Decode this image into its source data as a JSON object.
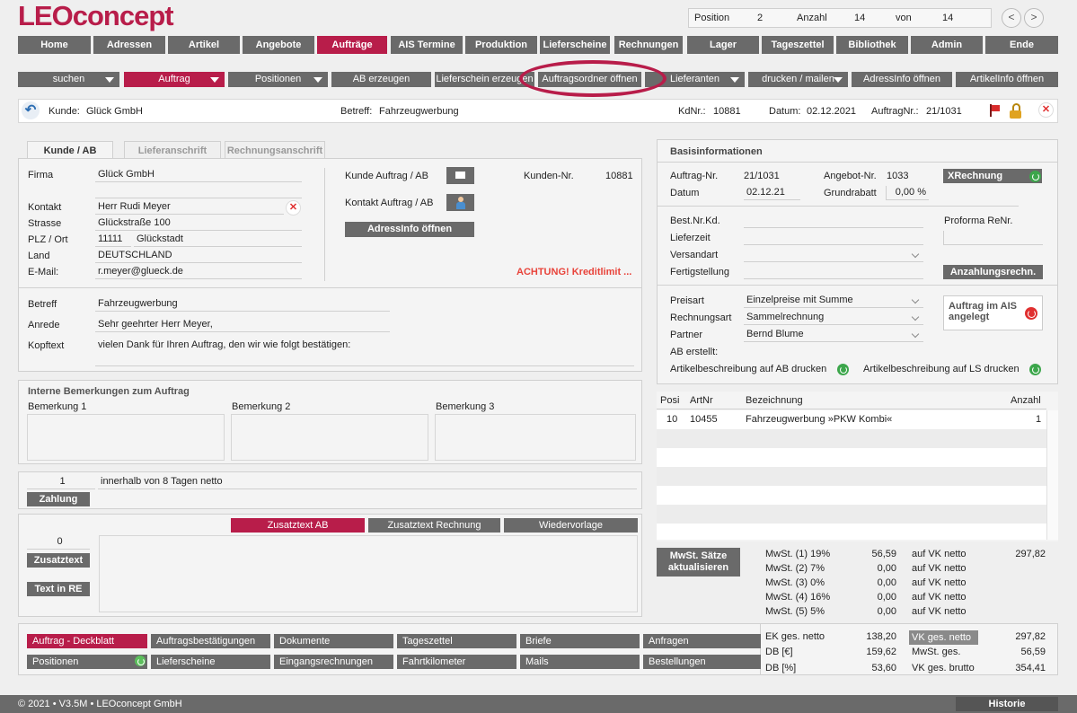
{
  "app": {
    "logo_leo": "LEO",
    "logo_concept": "concept"
  },
  "counter": {
    "position_label": "Position",
    "position": "2",
    "anzahl_label": "Anzahl",
    "anzahl": "14",
    "von_label": "von",
    "von": "14",
    "prev": "<",
    "next": ">"
  },
  "main_nav": [
    "Home",
    "Adressen",
    "Artikel",
    "Angebote",
    "Aufträge",
    "AIS Termine",
    "Produktion",
    "Lieferscheine",
    "Rechnungen",
    "Lager",
    "Tageszettel",
    "Bibliothek",
    "Admin",
    "Ende"
  ],
  "toolbar": [
    "suchen",
    "Auftrag",
    "Positionen",
    "AB erzeugen",
    "Lieferschein erzeugen",
    "Auftragsordner öffnen",
    "Lieferanten",
    "drucken / mailen",
    "AdressInfo öffnen",
    "ArtikelInfo öffnen"
  ],
  "infobar": {
    "kunde_label": "Kunde:",
    "kunde": "Glück GmbH",
    "betreff_label": "Betreff:",
    "betreff": "Fahrzeugwerbung",
    "kdnr_label": "KdNr.:",
    "kdnr": "10881",
    "datum_label": "Datum:",
    "datum": "02.12.2021",
    "auftragnr_label": "AuftragNr.:",
    "auftragnr": "21/1031"
  },
  "tabs": [
    "Kunde / AB",
    "Lieferanschrift",
    "Rechnungsanschrift"
  ],
  "kunde": {
    "firma_label": "Firma",
    "firma": "Glück GmbH",
    "kontakt_label": "Kontakt",
    "kontakt": "Herr Rudi Meyer",
    "strasse_label": "Strasse",
    "strasse": "Glückstraße 100",
    "plz_label": "PLZ / Ort",
    "plz": "11111",
    "ort": "Glückstadt",
    "land_label": "Land",
    "land": "DEUTSCHLAND",
    "email_label": "E-Mail:",
    "email": "r.meyer@glueck.de",
    "kunde_ab_label": "Kunde Auftrag / AB",
    "kontakt_ab_label": "Kontakt Auftrag / AB",
    "adressinfo_btn": "AdressInfo öffnen",
    "kundennr_label": "Kunden-Nr.",
    "kundennr": "10881",
    "warning": "ACHTUNG! Kreditlimit ...",
    "betreff_label": "Betreff",
    "betreff": "Fahrzeugwerbung",
    "anrede_label": "Anrede",
    "anrede": "Sehr geehrter Herr Meyer,",
    "kopftext_label": "Kopftext",
    "kopftext": "vielen Dank für Ihren Auftrag, den wir wie folgt bestätigen:"
  },
  "bemerkungen": {
    "title": "Interne Bemerkungen zum Auftrag",
    "b1": "Bemerkung 1",
    "b2": "Bemerkung 2",
    "b3": "Bemerkung 3"
  },
  "zahlung": {
    "nr": "1",
    "text": "innerhalb von 8 Tagen netto",
    "btn": "Zahlung"
  },
  "zusatz": {
    "count": "0",
    "btn_zusatztext": "Zusatztext",
    "btn_textinre": "Text in RE",
    "tab_ab": "Zusatztext AB",
    "tab_rechnung": "Zusatztext Rechnung",
    "tab_wiedervorlage": "Wiedervorlage"
  },
  "basis": {
    "title": "Basisinformationen",
    "auftragnr_label": "Auftrag-Nr.",
    "auftragnr": "21/1031",
    "angebotnr_label": "Angebot-Nr.",
    "angebotnr": "1033",
    "xrechnung_btn": "XRechnung",
    "datum_label": "Datum",
    "datum": "02.12.21",
    "grundrabatt_label": "Grundrabatt",
    "grundrabatt": "0,00 %",
    "bestnr_label": "Best.Nr.Kd.",
    "proforma_label": "Proforma ReNr.",
    "lieferzeit_label": "Lieferzeit",
    "versandart_label": "Versandart",
    "fertigstellung_label": "Fertigstellung",
    "anzahlung_btn": "Anzahlungsrechn.",
    "preisart_label": "Preisart",
    "preisart": "Einzelpreise mit Summe",
    "rechnungsart_label": "Rechnungsart",
    "rechnungsart": "Sammelrechnung",
    "partner_label": "Partner",
    "partner": "Bernd Blume",
    "ais_label": "Auftrag im AIS angelegt",
    "ab_erstellt_label": "AB erstellt:",
    "artikel_ab_label": "Artikelbeschreibung auf AB drucken",
    "artikel_ls_label": "Artikelbeschreibung auf LS drucken"
  },
  "positions": {
    "headers": [
      "Posi",
      "ArtNr",
      "Bezeichnung",
      "Anzahl"
    ],
    "rows": [
      {
        "posi": "10",
        "artnr": "10455",
        "bez": "Fahrzeugwerbung »PKW Kombi«",
        "anzahl": "1"
      }
    ]
  },
  "mwst": {
    "btn": "MwSt. Sätze aktualisieren",
    "rows": [
      {
        "label": "MwSt. (1) 19%",
        "value": "56,59",
        "basis": "auf VK netto",
        "basis_value": "297,82"
      },
      {
        "label": "MwSt. (2)  7%",
        "value": "0,00",
        "basis": "auf VK netto"
      },
      {
        "label": "MwSt. (3)  0%",
        "value": "0,00",
        "basis": "auf VK netto"
      },
      {
        "label": "MwSt. (4) 16%",
        "value": "0,00",
        "basis": "auf VK netto"
      },
      {
        "label": "MwSt. (5)  5%",
        "value": "0,00",
        "basis": "auf VK netto"
      }
    ]
  },
  "bottom_buttons": [
    "Auftrag - Deckblatt",
    "Auftragsbestätigungen",
    "Dokumente",
    "Tageszettel",
    "Briefe",
    "Anfragen",
    "Positionen",
    "Lieferscheine",
    "Eingangsrechnungen",
    "Fahrtkilometer",
    "Mails",
    "Bestellungen"
  ],
  "totals": {
    "ek_label": "EK ges. netto",
    "ek": "138,20",
    "db_label": "DB [€]",
    "db": "159,62",
    "dbp_label": "DB [%]",
    "dbp": "53,60",
    "vk_label": "VK ges. netto",
    "vk": "297,82",
    "mwst_label": "MwSt. ges.",
    "mwst": "56,59",
    "brutto_label": "VK ges. brutto",
    "brutto": "354,41"
  },
  "footer": {
    "copyright": "© 2021 • V3.5M • LEOconcept GmbH",
    "historie": "Historie"
  },
  "colors": {
    "accent": "#b81d4a",
    "button_grey": "#6a6a6a",
    "green": "#3ca64b",
    "warning": "#e8433a"
  }
}
